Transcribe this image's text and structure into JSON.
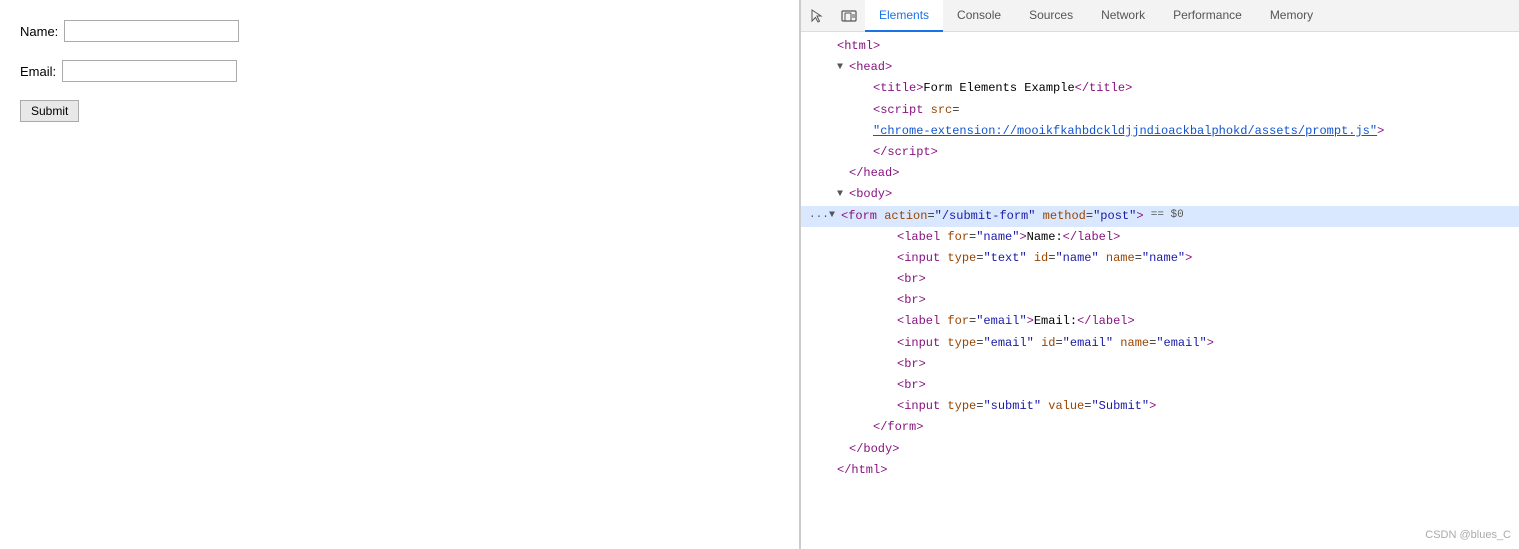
{
  "left": {
    "name_label": "Name:",
    "email_label": "Email:",
    "submit_label": "Submit"
  },
  "devtools": {
    "icons": {
      "cursor": "⬚",
      "device": "▭"
    },
    "tabs": [
      {
        "id": "elements",
        "label": "Elements",
        "active": true
      },
      {
        "id": "console",
        "label": "Console",
        "active": false
      },
      {
        "id": "sources",
        "label": "Sources",
        "active": false
      },
      {
        "id": "network",
        "label": "Network",
        "active": false
      },
      {
        "id": "performance",
        "label": "Performance",
        "active": false
      },
      {
        "id": "memory",
        "label": "Memory",
        "active": false
      }
    ],
    "code_lines": [
      {
        "indent": 0,
        "triangle": "",
        "dots": "",
        "content": "&lt;html&gt;",
        "highlighted": false
      },
      {
        "indent": 1,
        "triangle": "▼",
        "dots": "",
        "content": "&lt;head&gt;",
        "highlighted": false
      },
      {
        "indent": 2,
        "triangle": "",
        "dots": "",
        "content": "&lt;title&gt;Form Elements Example&lt;/title&gt;",
        "highlighted": false
      },
      {
        "indent": 2,
        "triangle": "",
        "dots": "",
        "content": "&lt;script src=",
        "highlighted": false
      },
      {
        "indent": 2,
        "triangle": "",
        "dots": "",
        "content_link": "chrome-extension://mooikfkahbdckldjjndioackbalphokd/assets/prompt.js",
        "content_suffix": "&gt;",
        "highlighted": false
      },
      {
        "indent": 2,
        "triangle": "",
        "dots": "",
        "content": "&lt;/script&gt;",
        "highlighted": false
      },
      {
        "indent": 1,
        "triangle": "",
        "dots": "",
        "content": "&lt;/head&gt;",
        "highlighted": false
      },
      {
        "indent": 1,
        "triangle": "▼",
        "dots": "",
        "content": "&lt;body&gt;",
        "highlighted": false
      },
      {
        "indent": 2,
        "triangle": "▼",
        "dots": "...",
        "content_form": true,
        "highlighted": true
      },
      {
        "indent": 3,
        "triangle": "",
        "dots": "",
        "content": "&lt;label for=&quot;name&quot;&gt;Name:&lt;/label&gt;",
        "highlighted": false
      },
      {
        "indent": 3,
        "triangle": "",
        "dots": "",
        "content": "&lt;input type=&quot;text&quot; id=&quot;name&quot; name=&quot;name&quot;&gt;",
        "highlighted": false
      },
      {
        "indent": 3,
        "triangle": "",
        "dots": "",
        "content": "&lt;br&gt;",
        "highlighted": false
      },
      {
        "indent": 3,
        "triangle": "",
        "dots": "",
        "content": "&lt;br&gt;",
        "highlighted": false
      },
      {
        "indent": 3,
        "triangle": "",
        "dots": "",
        "content": "&lt;label for=&quot;email&quot;&gt;Email:&lt;/label&gt;",
        "highlighted": false
      },
      {
        "indent": 3,
        "triangle": "",
        "dots": "",
        "content": "&lt;input type=&quot;email&quot; id=&quot;email&quot; name=&quot;email&quot;&gt;",
        "highlighted": false
      },
      {
        "indent": 3,
        "triangle": "",
        "dots": "",
        "content": "&lt;br&gt;",
        "highlighted": false
      },
      {
        "indent": 3,
        "triangle": "",
        "dots": "",
        "content": "&lt;br&gt;",
        "highlighted": false
      },
      {
        "indent": 3,
        "triangle": "",
        "dots": "",
        "content": "&lt;input type=&quot;submit&quot; value=&quot;Submit&quot;&gt;",
        "highlighted": false
      },
      {
        "indent": 2,
        "triangle": "",
        "dots": "",
        "content": "&lt;/form&gt;",
        "highlighted": false
      },
      {
        "indent": 1,
        "triangle": "",
        "dots": "",
        "content": "&lt;/body&gt;",
        "highlighted": false
      },
      {
        "indent": 0,
        "triangle": "",
        "dots": "",
        "content": "&lt;/html&gt;",
        "highlighted": false
      }
    ]
  },
  "watermark": "CSDN @blues_C"
}
